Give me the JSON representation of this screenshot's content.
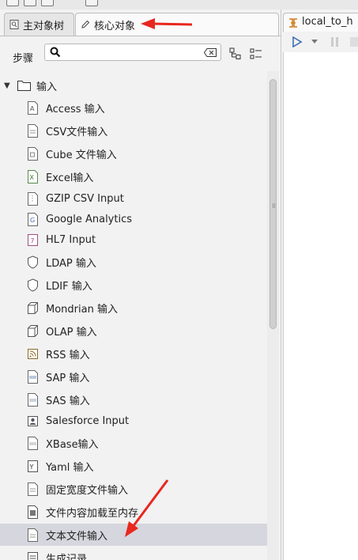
{
  "left_panel": {
    "tabs": [
      {
        "label": "主对象树",
        "icon": "tree-icon"
      },
      {
        "label": "核心对象",
        "icon": "pencil-icon"
      }
    ],
    "steps_label": "步骤",
    "search": {
      "value": "",
      "placeholder": ""
    },
    "tree": {
      "folder": {
        "label": "输入",
        "icon": "folder-icon",
        "expanded": true
      },
      "items": [
        {
          "label": "Access 输入",
          "icon": "access-icon"
        },
        {
          "label": "CSV文件输入",
          "icon": "csv-file-icon"
        },
        {
          "label": "Cube 文件输入",
          "icon": "cube-file-icon"
        },
        {
          "label": "Excel输入",
          "icon": "excel-icon"
        },
        {
          "label": "GZIP CSV Input",
          "icon": "gzip-file-icon"
        },
        {
          "label": "Google Analytics",
          "icon": "google-analytics-icon"
        },
        {
          "label": "HL7 Input",
          "icon": "hl7-icon"
        },
        {
          "label": "LDAP 输入",
          "icon": "ldap-shield-icon"
        },
        {
          "label": "LDIF 输入",
          "icon": "ldif-shield-icon"
        },
        {
          "label": "Mondrian 输入",
          "icon": "mondrian-cube-icon"
        },
        {
          "label": "OLAP 输入",
          "icon": "olap-cube-icon"
        },
        {
          "label": "RSS 输入",
          "icon": "rss-icon"
        },
        {
          "label": "SAP 输入",
          "icon": "sap-icon"
        },
        {
          "label": "SAS 输入",
          "icon": "sas-icon"
        },
        {
          "label": "Salesforce Input",
          "icon": "salesforce-icon"
        },
        {
          "label": "XBase输入",
          "icon": "xbase-icon"
        },
        {
          "label": "Yaml 输入",
          "icon": "yaml-icon"
        },
        {
          "label": "固定宽度文件输入",
          "icon": "fixed-width-file-icon"
        },
        {
          "label": "文件内容加载至内存",
          "icon": "load-file-content-icon"
        },
        {
          "label": "文本文件输入",
          "icon": "text-file-icon",
          "selected": true
        },
        {
          "label": "生成记录",
          "icon": "generate-rows-icon"
        }
      ]
    }
  },
  "right_panel": {
    "tab": {
      "label": "local_to_h",
      "icon": "transformation-icon"
    }
  },
  "colors": {
    "selected_row": "#d6d6de",
    "annotation_arrow": "#e8271e",
    "run_icon": "#3d6fb3"
  }
}
